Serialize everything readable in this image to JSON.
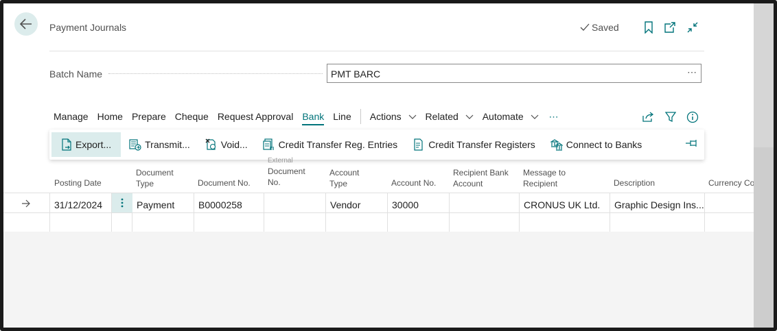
{
  "header": {
    "title": "Payment Journals",
    "saved_label": "Saved"
  },
  "batch": {
    "label": "Batch Name",
    "value": "PMT BARC",
    "more": "⋯"
  },
  "menu": {
    "items": [
      "Manage",
      "Home",
      "Prepare",
      "Cheque",
      "Request Approval",
      "Bank",
      "Line"
    ],
    "active": "Bank",
    "dropdowns": [
      "Actions",
      "Related",
      "Automate"
    ],
    "more": "⋯"
  },
  "ribbon": {
    "buttons": [
      "Export...",
      "Transmit...",
      "Void...",
      "Credit Transfer Reg. Entries",
      "Credit Transfer Registers",
      "Connect to Banks"
    ]
  },
  "table": {
    "columns": [
      {
        "label": "Posting Date"
      },
      {
        "label": "Document Type"
      },
      {
        "label": "Document No."
      },
      {
        "label": "External Document No."
      },
      {
        "label": "Account Type"
      },
      {
        "label": "Account No."
      },
      {
        "label": "Recipient Bank Account"
      },
      {
        "label": "Message to Recipient"
      },
      {
        "label": "Description"
      },
      {
        "label": "Currency Code"
      }
    ],
    "header_lines": {
      "doc_type_1": "Document",
      "doc_type_2": "Type",
      "ext_doc_0": "External",
      "ext_doc_1": "Document",
      "ext_doc_2": "No.",
      "acc_type_1": "Account",
      "acc_type_2": "Type",
      "recip_1": "Recipient Bank",
      "recip_2": "Account",
      "msg_1": "Message to",
      "msg_2": "Recipient",
      "currency": "Currency Co"
    },
    "rows": [
      {
        "posting_date": "31/12/2024",
        "document_type": "Payment",
        "document_no": "B0000258",
        "external_document_no": "",
        "account_type": "Vendor",
        "account_no": "30000",
        "recipient_bank_account": "",
        "message_to_recipient": "CRONUS UK Ltd.",
        "description": "Graphic Design Ins...",
        "currency_code": ""
      }
    ]
  },
  "colors": {
    "accent": "#00737a",
    "highlight": "#dbecec",
    "gutter": "#cdcdcd"
  }
}
